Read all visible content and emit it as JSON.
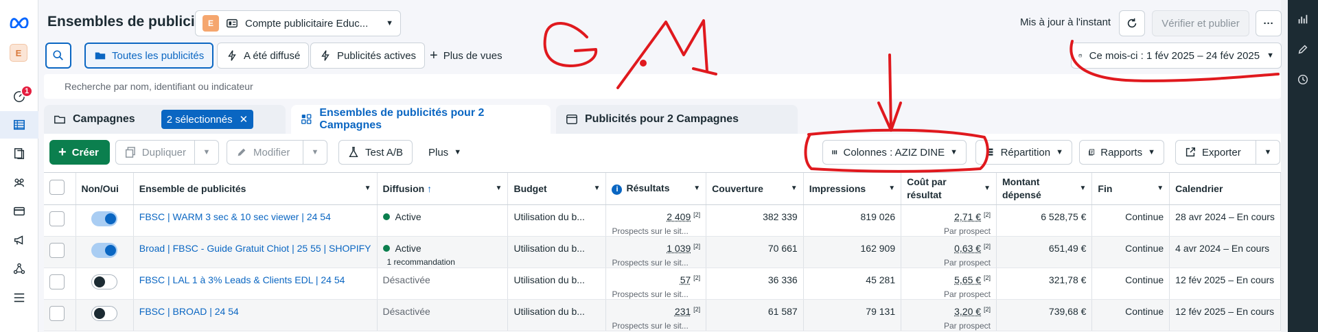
{
  "header": {
    "title": "Ensembles de publicités",
    "account_initial": "E",
    "account_name": "Compte publicitaire Educ...",
    "updated": "Mis à jour à l'instant",
    "publish": "Vérifier et publier",
    "more": "···"
  },
  "rail": {
    "avatar": "E",
    "badge": "1"
  },
  "filters": {
    "all": "Toutes les publicités",
    "delivered": "A été diffusé",
    "active": "Publicités actives",
    "more_views": "Plus de vues",
    "date_range": "Ce mois-ci : 1 fév 2025 – 24 fév 2025"
  },
  "search": {
    "placeholder": "Recherche par nom, identifiant ou indicateur"
  },
  "tabs": {
    "campaigns": "Campagnes",
    "selected": "2 sélectionnés",
    "adsets": "Ensembles de publicités pour 2 Campagnes",
    "ads": "Publicités pour 2 Campagnes"
  },
  "toolbar": {
    "create": "Créer",
    "duplicate": "Dupliquer",
    "edit": "Modifier",
    "abtest": "Test A/B",
    "plus": "Plus",
    "columns": "Colonnes : AZIZ DINE",
    "breakdown": "Répartition",
    "reports": "Rapports",
    "export": "Exporter"
  },
  "table": {
    "headers": {
      "toggle": "Non/Oui",
      "adset": "Ensemble de publicités",
      "delivery": "Diffusion",
      "budget": "Budget",
      "results": "Résultats",
      "reach": "Couverture",
      "impressions": "Impressions",
      "cpr_1": "Coût par",
      "cpr_2": "résultat",
      "spent_1": "Montant",
      "spent_2": "dépensé",
      "end": "Fin",
      "schedule": "Calendrier"
    },
    "rows": [
      {
        "name": "FBSC | WARM 3 sec & 10 sec viewer | 24 54",
        "delivery": "Active",
        "reco": "",
        "budget": "Utilisation du b...",
        "results": "2 409",
        "results_sup": "[2]",
        "results_sub": "Prospects sur le sit...",
        "reach": "382 339",
        "impressions": "819 026",
        "cpr": "2,71 €",
        "cpr_sup": "[2]",
        "cpr_sub": "Par prospect",
        "spent": "6 528,75 €",
        "end": "Continue",
        "schedule": "28 avr 2024 – En cours"
      },
      {
        "name": "Broad | FBSC - Guide Gratuit Chiot | 25 55 | SHOPIFY",
        "delivery": "Active",
        "reco": "1 recommandation",
        "budget": "Utilisation du b...",
        "results": "1 039",
        "results_sup": "[2]",
        "results_sub": "Prospects sur le sit...",
        "reach": "70 661",
        "impressions": "162 909",
        "cpr": "0,63 €",
        "cpr_sup": "[2]",
        "cpr_sub": "Par prospect",
        "spent": "651,49 €",
        "end": "Continue",
        "schedule": "4 avr 2024 – En cours"
      },
      {
        "name": "FBSC | LAL 1 à 3% Leads & Clients EDL | 24 54",
        "delivery": "Désactivée",
        "reco": "",
        "budget": "Utilisation du b...",
        "results": "57",
        "results_sup": "[2]",
        "results_sub": "Prospects sur le sit...",
        "reach": "36 336",
        "impressions": "45 281",
        "cpr": "5,65 €",
        "cpr_sup": "[2]",
        "cpr_sub": "Par prospect",
        "spent": "321,78 €",
        "end": "Continue",
        "schedule": "12 fév 2025 – En cours"
      },
      {
        "name": "FBSC | BROAD | 24 54",
        "delivery": "Désactivée",
        "reco": "",
        "budget": "Utilisation du b...",
        "results": "231",
        "results_sup": "[2]",
        "results_sub": "Prospects sur le sit...",
        "reach": "61 587",
        "impressions": "79 131",
        "cpr": "3,20 €",
        "cpr_sup": "[2]",
        "cpr_sub": "Par prospect",
        "spent": "739,68 €",
        "end": "Continue",
        "schedule": "12 fév 2025 – En cours"
      }
    ]
  },
  "annotation": {
    "handwriting": "G.M"
  },
  "colors": {
    "primary": "#0a66c2",
    "create": "#0b7f4e",
    "annotation": "#e0191e",
    "badge": "#e41e3f"
  }
}
